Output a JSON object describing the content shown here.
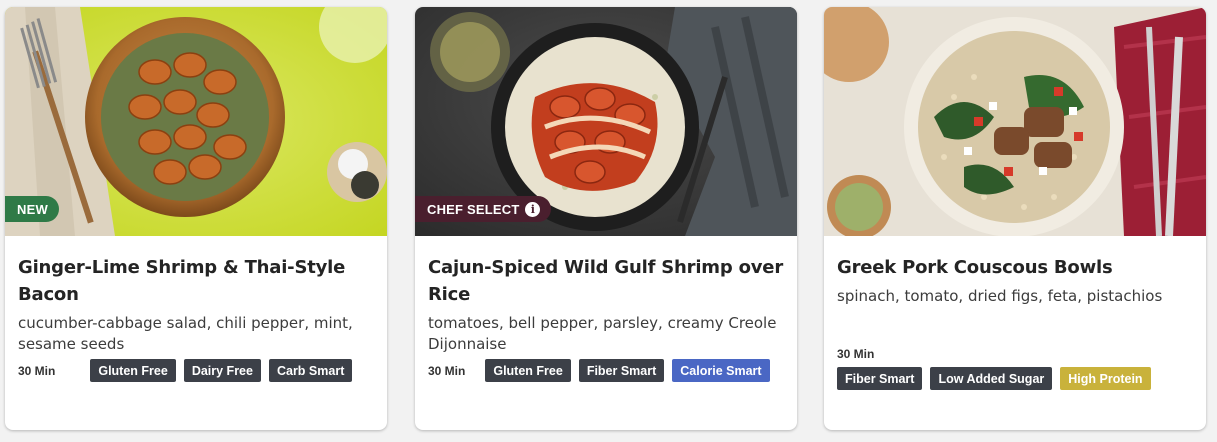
{
  "cards": [
    {
      "badge": "NEW",
      "title": "Ginger-Lime Shrimp & Thai-Style Bacon",
      "description": "cucumber-cabbage salad, chili pepper, mint, sesame seeds",
      "time": "30 Min",
      "tags": [
        "Gluten Free",
        "Dairy Free",
        "Carb Smart"
      ]
    },
    {
      "badge": "CHEF SELECT",
      "badge_icon": "info-icon",
      "title": "Cajun-Spiced Wild Gulf Shrimp over Rice",
      "description": "tomatoes, bell pepper, parsley, creamy Creole Dijonnaise",
      "time": "30 Min",
      "tags": [
        "Gluten Free",
        "Fiber Smart",
        "Calorie Smart"
      ]
    },
    {
      "title": "Greek Pork Couscous Bowls",
      "description": "spinach, tomato, dried figs, feta, pistachios",
      "time": "30 Min",
      "tags": [
        "Fiber Smart",
        "Low Added Sugar",
        "High Protein"
      ]
    }
  ],
  "colors": {
    "tag_default": "#3c4048",
    "tag_calorie_smart": "#4a67c4",
    "tag_high_protein": "#c9b23b",
    "badge_new": "#2f7a47",
    "badge_chef_select": "#4a1f2e"
  }
}
